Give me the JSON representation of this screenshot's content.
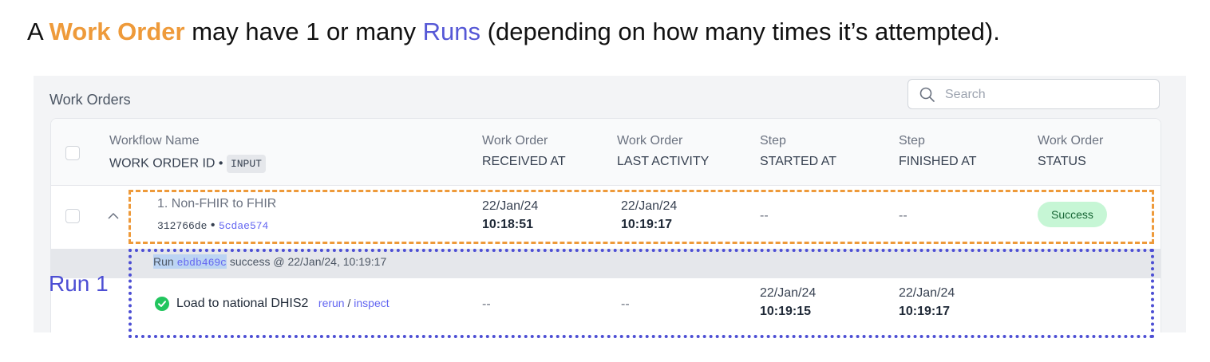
{
  "caption": {
    "prefix": "A ",
    "work_order": "Work Order",
    "middle": " may have 1 or many ",
    "runs": "Runs",
    "suffix": " (depending on how many times it’s attempted)."
  },
  "panel": {
    "title": "Work Orders",
    "search_placeholder": "Search"
  },
  "columns": {
    "workflow": {
      "line1": "Workflow Name",
      "line2": "WORK ORDER ID •",
      "badge": "INPUT"
    },
    "received": {
      "line1": "Work Order",
      "line2": "RECEIVED AT"
    },
    "activity": {
      "line1": "Work Order",
      "line2": "LAST ACTIVITY"
    },
    "started": {
      "line1": "Step",
      "line2": "STARTED AT"
    },
    "finished": {
      "line1": "Step",
      "line2": "FINISHED AT"
    },
    "status": {
      "line1": "Work Order",
      "line2": "STATUS"
    }
  },
  "work_order": {
    "name": "1. Non-FHIR to FHIR",
    "id": "312766de",
    "separator": "•",
    "input_id": "5cdae574",
    "received_date": "22/Jan/24",
    "received_time": "10:18:51",
    "activity_date": "22/Jan/24",
    "activity_time": "10:19:17",
    "started": "--",
    "finished": "--",
    "status": "Success"
  },
  "run": {
    "prefix": "Run ",
    "id": "ebdb469c",
    "summary": " success @ 22/Jan/24, 10:19:17"
  },
  "step": {
    "name": "Load to national DHIS2",
    "rerun": "rerun",
    "slash": " / ",
    "inspect": "inspect",
    "received": "--",
    "activity": "--",
    "started_date": "22/Jan/24",
    "started_time": "10:19:15",
    "finished_date": "22/Jan/24",
    "finished_time": "10:19:17"
  },
  "annotation": {
    "run_label": "Run 1"
  },
  "colors": {
    "work_order_accent": "#ee9a3a",
    "run_accent": "#4d4fd4",
    "success_badge": "#c6f6d5",
    "link": "#6366f1"
  }
}
